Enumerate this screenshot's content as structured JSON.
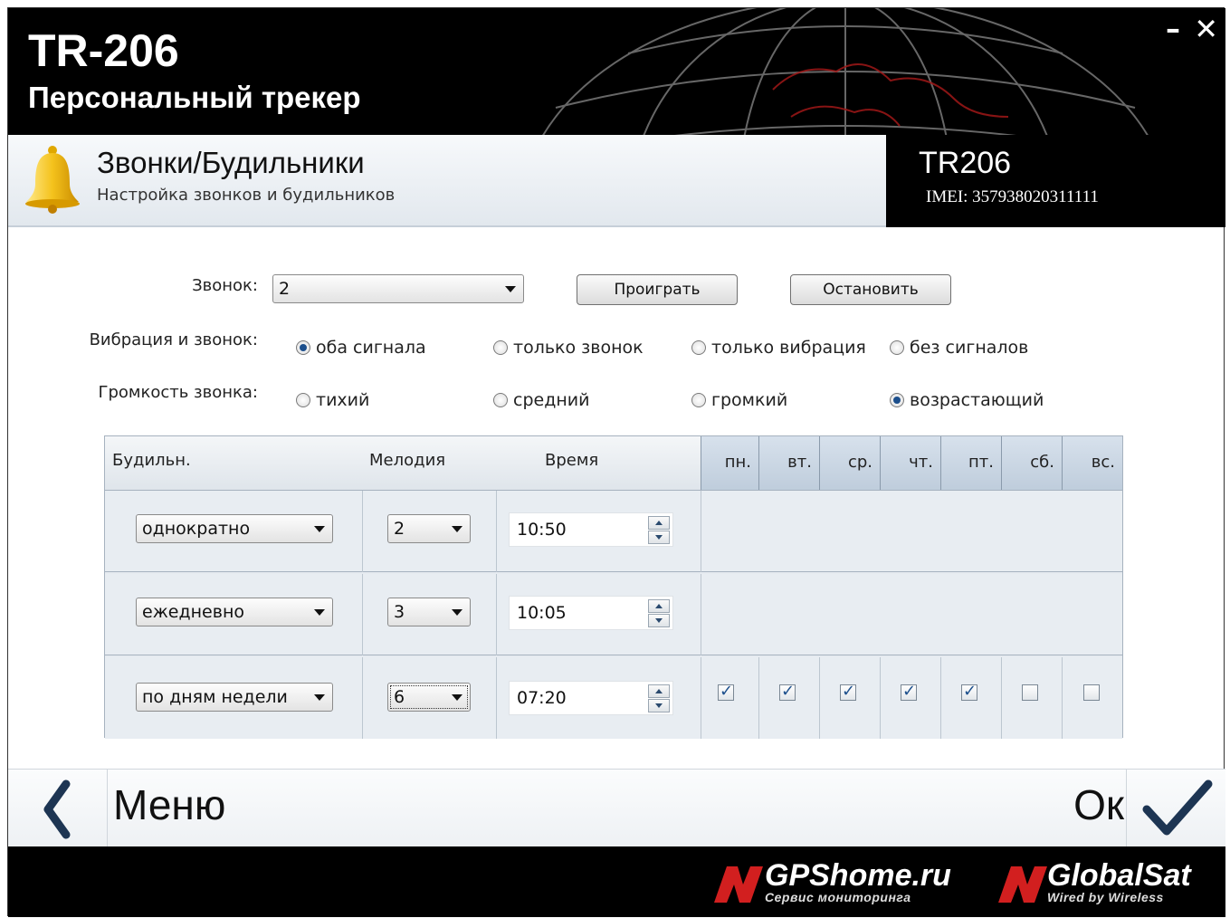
{
  "window": {
    "minimize": "–",
    "close": "✕"
  },
  "brand": {
    "title": "TR-206",
    "subtitle": "Персональный трекер"
  },
  "section": {
    "title": "Звонки/Будильники",
    "subtitle": "Настройка звонков и будильников"
  },
  "device": {
    "name": "TR206",
    "imei": "IMEI: 357938020311111"
  },
  "form": {
    "ring_label": "Звонок:",
    "ring_value": "2",
    "play_button": "Проиграть",
    "stop_button": "Остановить",
    "vibration_label": "Вибрация и звонок:",
    "vibration_options": [
      {
        "label": "оба сигнала",
        "selected": true
      },
      {
        "label": "только звонок",
        "selected": false
      },
      {
        "label": "только вибрация",
        "selected": false
      },
      {
        "label": "без сигналов",
        "selected": false
      }
    ],
    "volume_label": "Громкость звонка:",
    "volume_options": [
      {
        "label": "тихий",
        "selected": false
      },
      {
        "label": "средний",
        "selected": false
      },
      {
        "label": "громкий",
        "selected": false
      },
      {
        "label": "возрастающий",
        "selected": true
      }
    ]
  },
  "alarms": {
    "headers": {
      "alarm": "Будильн.",
      "melody": "Мелодия",
      "time": "Время"
    },
    "days": [
      "пн.",
      "вт.",
      "ср.",
      "чт.",
      "пт.",
      "сб.",
      "вс."
    ],
    "rows": [
      {
        "mode": "однократно",
        "melody": "2",
        "time": "10:50",
        "days": null
      },
      {
        "mode": "ежедневно",
        "melody": "3",
        "time": "10:05",
        "days": null
      },
      {
        "mode": "по дням недели",
        "melody": "6",
        "time": "07:20",
        "days": [
          true,
          true,
          true,
          true,
          true,
          false,
          false
        ]
      }
    ]
  },
  "nav": {
    "menu": "Меню",
    "ok": "Ок"
  },
  "footer": {
    "logo1_name": "GPShome.ru",
    "logo1_tag": "Сервис мониторинга",
    "logo2_name": "GlobalSat",
    "logo2_tag": "Wired by Wireless"
  },
  "colors": {
    "header_bg": "#000000",
    "accent_red": "#d21f1f",
    "check_blue": "#1c4f8c",
    "day_header": "#c9d6e3"
  }
}
